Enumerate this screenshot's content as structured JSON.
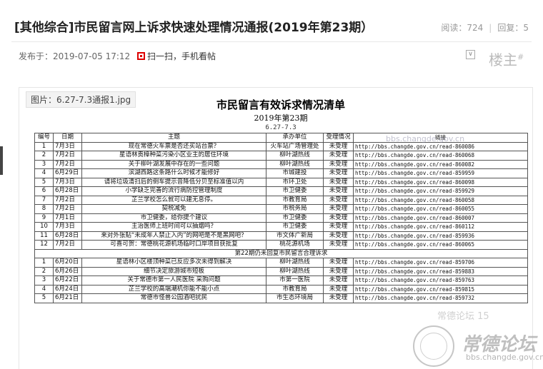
{
  "post": {
    "title": "[其他综合]市民留言网上诉求快速处理情况通报(2019年第23期）",
    "views_label": "阅读：",
    "views": "724",
    "replies_label": "回复：",
    "replies": "5",
    "published_label": "发布于：",
    "published_at": "2019-07-05 17:12",
    "scan_label": "扫一扫，手机看帖",
    "floor_label": "楼主",
    "floor_mark": "#"
  },
  "attachment": {
    "label": "图片：6.27-7.3通报1.jpg"
  },
  "document": {
    "title": "市民留言有效诉求情况清单",
    "subtitle": "2019年第23期",
    "date_range": "6.27-7.3",
    "headers": [
      "编号",
      "日期",
      "主题",
      "承办单位",
      "受理情况",
      "链接"
    ],
    "rows": [
      [
        "1",
        "7月3日",
        "现在常德火车票是否还买站台票？",
        "火车站广场管理处",
        "未受理",
        "http://bbs.changde.gov.cn/read-860086"
      ],
      [
        "2",
        "7月2日",
        "星语林贡樟种菜污染小区业主的居住环境",
        "柳叶湖热线",
        "未受理",
        "http://bbs.changde.gov.cn/read-860068"
      ],
      [
        "3",
        "7月2日",
        "关于柳叶湖发展中存在的一些问题",
        "柳叶湖热线",
        "未受理",
        "http://bbs.changde.gov.cn/read-860082"
      ],
      [
        "4",
        "6月29日",
        "滨湖西路这条路什么时候才能修好",
        "市城建投",
        "未受理",
        "http://bbs.changde.gov.cn/read-859959"
      ],
      [
        "5",
        "7月3日",
        "请将垃圾清扫后的倒车提示音降低分贝至标准值以内",
        "市环卫处",
        "未受理",
        "http://bbs.changde.gov.cn/read-860098"
      ],
      [
        "6",
        "6月28日",
        "小学缺乏完善的流行病防控管理制度",
        "市卫健委",
        "未受理",
        "http://bbs.changde.gov.cn/read-859929"
      ],
      [
        "7",
        "7月2日",
        "芷兰学校怎么就可以建无息停。",
        "市教育局",
        "未受理",
        "http://bbs.changde.gov.cn/read-860058"
      ],
      [
        "8",
        "7月2日",
        "契税减免",
        "市税务局",
        "未受理",
        "http://bbs.changde.gov.cn/read-860055"
      ],
      [
        "9",
        "7月1日",
        "市卫健委，给你提个建议",
        "市卫健委",
        "未受理",
        "http://bbs.changde.gov.cn/read-860007"
      ],
      [
        "10",
        "7月3日",
        "主治医师上班时间可以抽烟吗？",
        "市卫健委",
        "未受理",
        "http://bbs.changde.gov.cn/read-860112"
      ],
      [
        "11",
        "6月28日",
        "来对外张贴“未成年人禁止入内”的网吧是不是黑网吧？",
        "市文体广新局",
        "未受理",
        "http://bbs.changde.gov.cn/read-859936"
      ],
      [
        "12",
        "7月2日",
        "可喜可贺：常德桃花源机场临时口岸项目获批复",
        "桃花源机场",
        "未受理",
        "http://bbs.changde.gov.cn/read-860065"
      ]
    ],
    "section_title": "第22期仍未回复市民留言合理诉求",
    "rows2": [
      [
        "1",
        "6月20日",
        "星语林小区楼顶种菜已反应多次未得到解决",
        "柳叶湖热线",
        "未受理",
        "http://bbs.changde.gov.cn/read-859706"
      ],
      [
        "2",
        "6月26日",
        "细节决定旅游城市短板",
        "柳叶湖热线",
        "未受理",
        "http://bbs.changde.gov.cn/read-859883"
      ],
      [
        "3",
        "6月22日",
        "关于常德市第一人民医院 采购问题",
        "市第一医院",
        "未受理",
        "http://bbs.changde.gov.cn/read-859763"
      ],
      [
        "4",
        "6月24日",
        "芷兰学校的高端潮机你能不能小点",
        "市教育局",
        "未受理",
        "http://bbs.changde.gov.cn/read-859815"
      ],
      [
        "5",
        "6月21日",
        "常德市怪兽公园酒吧扰民",
        "市生态环境局",
        "未受理",
        "http://bbs.changde.gov.cn/read-859732"
      ]
    ]
  },
  "watermark": {
    "url_text": "bbs.changde.gov.cn",
    "brand_top": "常德论坛 15",
    "brand": "常德论坛",
    "domain": "bbs.changde.gov.cn"
  }
}
